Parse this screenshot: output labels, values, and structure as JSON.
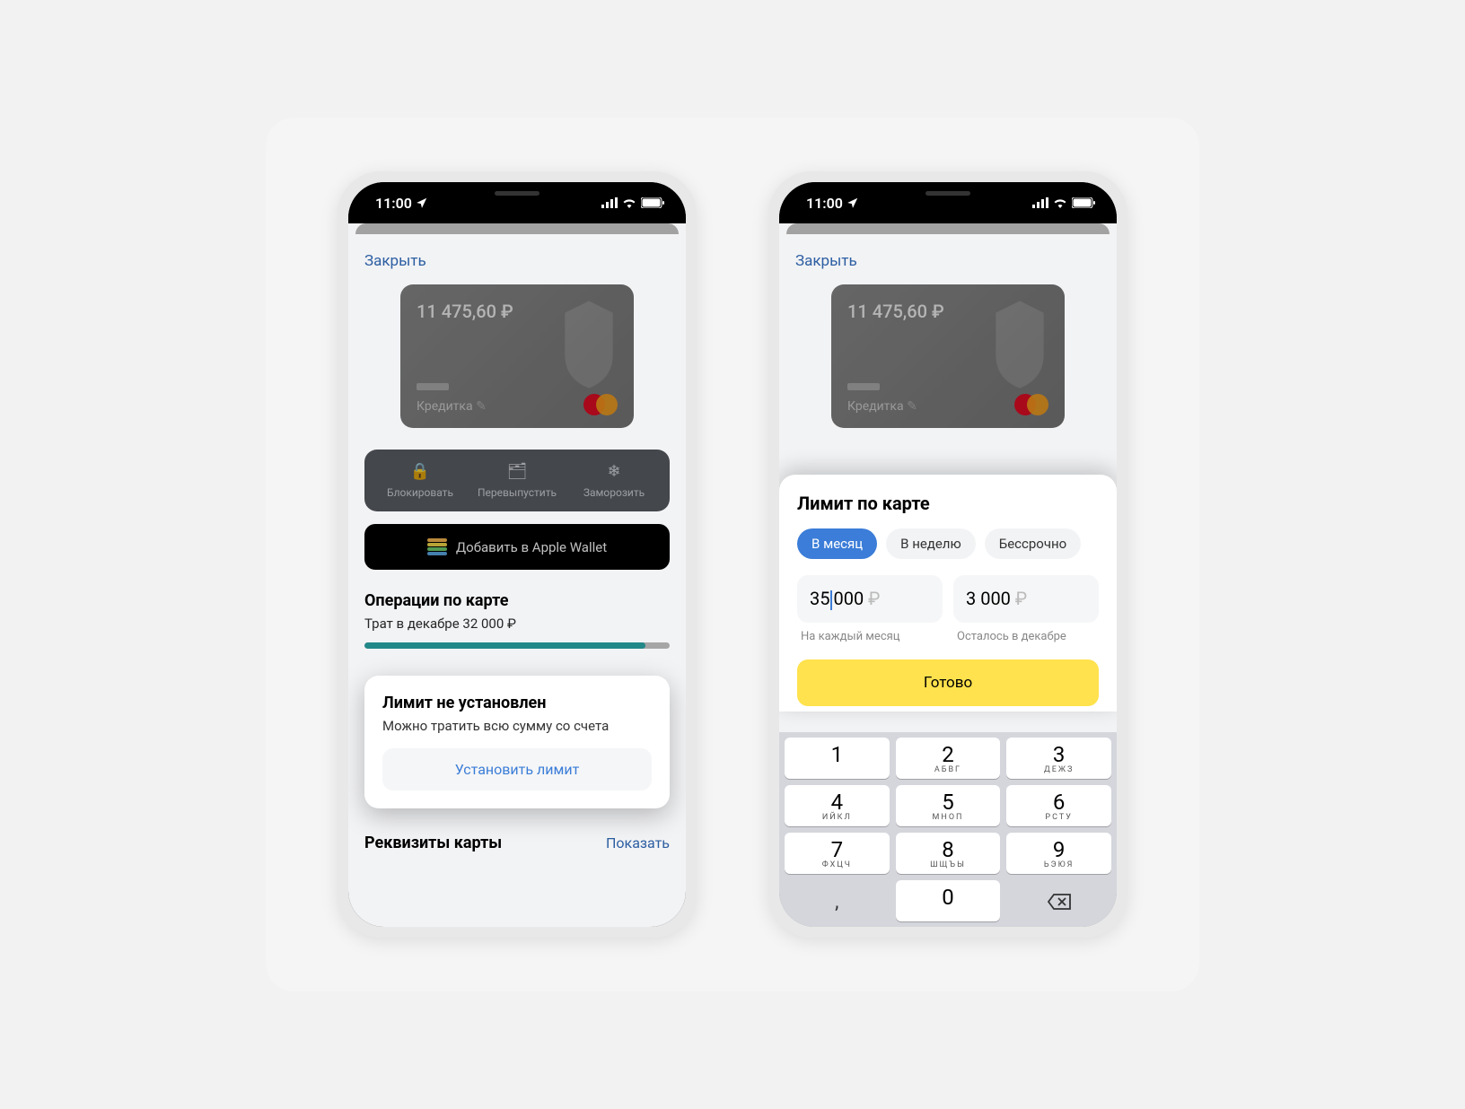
{
  "status": {
    "time": "11:00"
  },
  "header": {
    "close": "Закрыть"
  },
  "card": {
    "balance": "11 475,60 ₽",
    "type": "Кредитка"
  },
  "actions": {
    "block": "Блокировать",
    "reissue": "Перевыпустить",
    "freeze": "Заморозить"
  },
  "wallet": {
    "label": "Добавить в Apple Wallet"
  },
  "ops": {
    "title": "Операции по карте",
    "subtitle": "Трат в декабре 32 000 ₽"
  },
  "limit_prompt": {
    "title": "Лимит не установлен",
    "subtitle": "Можно тратить всю сумму со счета",
    "button": "Установить лимит"
  },
  "details": {
    "title": "Реквизиты карты",
    "show": "Показать"
  },
  "sheet": {
    "title": "Лимит по карте",
    "chips": {
      "month": "В месяц",
      "week": "В неделю",
      "unlimited": "Бессрочно"
    },
    "input1_pre": "35",
    "input1_post": "000",
    "input1_cur": " ₽",
    "input2_val": "3 000",
    "input2_cur": " ₽",
    "label1": "На каждый месяц",
    "label2": "Осталось в декабре",
    "done": "Готово"
  },
  "keypad": {
    "k1": {
      "n": "1",
      "s": ""
    },
    "k2": {
      "n": "2",
      "s": "АБВГ"
    },
    "k3": {
      "n": "3",
      "s": "ДЕЖЗ"
    },
    "k4": {
      "n": "4",
      "s": "ИЙКЛ"
    },
    "k5": {
      "n": "5",
      "s": "МНОП"
    },
    "k6": {
      "n": "6",
      "s": "РСТУ"
    },
    "k7": {
      "n": "7",
      "s": "ФХЦЧ"
    },
    "k8": {
      "n": "8",
      "s": "ШЩЪЫ"
    },
    "k9": {
      "n": "9",
      "s": "ЬЭЮЯ"
    },
    "comma": ",",
    "k0": {
      "n": "0",
      "s": ""
    }
  }
}
